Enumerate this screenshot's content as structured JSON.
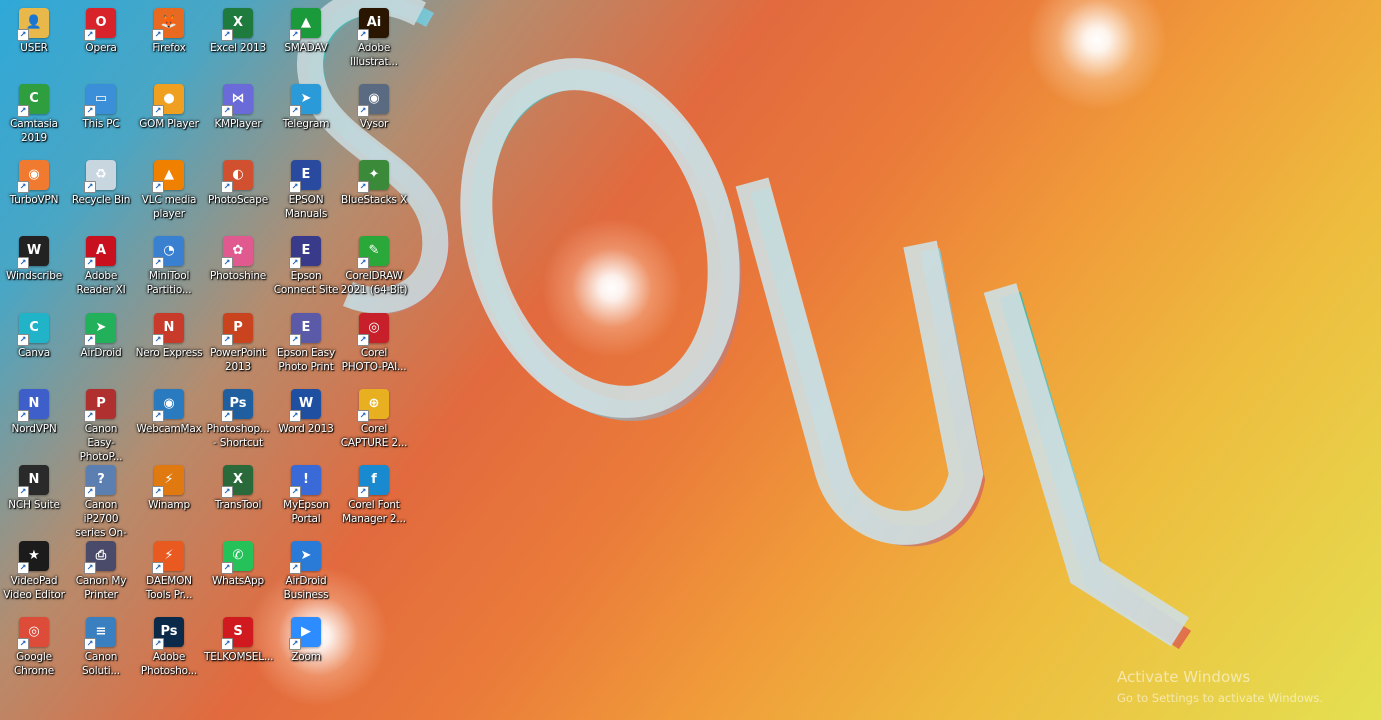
{
  "desktop": {
    "icons": [
      {
        "label": "USER",
        "icon": "user-folder-icon",
        "color": "#e8b84a",
        "glyph": "👤"
      },
      {
        "label": "Camtasia\n2019",
        "icon": "camtasia-icon",
        "color": "#2e9e3f",
        "glyph": "C"
      },
      {
        "label": "TurboVPN",
        "icon": "turbovpn-icon",
        "color": "#f07a30",
        "glyph": "◉"
      },
      {
        "label": "Windscribe",
        "icon": "windscribe-icon",
        "color": "#222222",
        "glyph": "W"
      },
      {
        "label": "Canva",
        "icon": "canva-icon",
        "color": "#21b4c8",
        "glyph": "C"
      },
      {
        "label": "NordVPN",
        "icon": "nordvpn-icon",
        "color": "#3e5fc9",
        "glyph": "N"
      },
      {
        "label": "NCH Suite",
        "icon": "nch-suite-icon",
        "color": "#2a2a2a",
        "glyph": "N"
      },
      {
        "label": "VideoPad\nVideo Editor",
        "icon": "videopad-icon",
        "color": "#1b1b1b",
        "glyph": "★"
      },
      {
        "label": "Google\nChrome",
        "icon": "chrome-icon",
        "color": "#dd4b39",
        "glyph": "◎"
      },
      {
        "label": "Opera",
        "icon": "opera-icon",
        "color": "#d8232a",
        "glyph": "O"
      },
      {
        "label": "This PC",
        "icon": "this-pc-icon",
        "color": "#3a8fd8",
        "glyph": "▭"
      },
      {
        "label": "Recycle Bin",
        "icon": "recycle-bin-icon",
        "color": "#c8d6e0",
        "glyph": "♻"
      },
      {
        "label": "Adobe\nReader XI",
        "icon": "adobe-reader-icon",
        "color": "#c8101e",
        "glyph": "A"
      },
      {
        "label": "AirDroid",
        "icon": "airdroid-icon",
        "color": "#22b05a",
        "glyph": "➤"
      },
      {
        "label": "Canon\nEasy-PhotoP...",
        "icon": "canon-easy-photoprint-icon",
        "color": "#b03030",
        "glyph": "P"
      },
      {
        "label": "Canon iP2700\nseries On-sc...",
        "icon": "canon-manual-icon",
        "color": "#5a7fb0",
        "glyph": "?"
      },
      {
        "label": "Canon My\nPrinter",
        "icon": "canon-my-printer-icon",
        "color": "#4a4a6a",
        "glyph": "⎙"
      },
      {
        "label": "Canon\nSoluti...",
        "icon": "canon-solution-icon",
        "color": "#3a80c0",
        "glyph": "≡"
      },
      {
        "label": "Firefox",
        "icon": "firefox-icon",
        "color": "#e86a20",
        "glyph": "🦊"
      },
      {
        "label": "GOM Player",
        "icon": "gom-player-icon",
        "color": "#f0a020",
        "glyph": "●"
      },
      {
        "label": "VLC media\nplayer",
        "icon": "vlc-icon",
        "color": "#f08000",
        "glyph": "▲"
      },
      {
        "label": "MiniTool\nPartitio...",
        "icon": "minitool-partition-icon",
        "color": "#3a80d0",
        "glyph": "◔"
      },
      {
        "label": "Nero Express",
        "icon": "nero-express-icon",
        "color": "#c83a2a",
        "glyph": "N"
      },
      {
        "label": "WebcamMax",
        "icon": "webcammax-icon",
        "color": "#2a7ac0",
        "glyph": "◉"
      },
      {
        "label": "Winamp",
        "icon": "winamp-icon",
        "color": "#e07a10",
        "glyph": "⚡"
      },
      {
        "label": "DAEMON\nTools Pr...",
        "icon": "daemon-tools-icon",
        "color": "#e85a20",
        "glyph": "⚡"
      },
      {
        "label": "Adobe\nPhotosho...",
        "icon": "adobe-photoshop-icon",
        "color": "#0b2a4a",
        "glyph": "Ps"
      },
      {
        "label": "Excel 2013",
        "icon": "excel-icon",
        "color": "#1f7a3e",
        "glyph": "X"
      },
      {
        "label": "KMPlayer",
        "icon": "kmplayer-icon",
        "color": "#6a6ad8",
        "glyph": "⋈"
      },
      {
        "label": "PhotoScape",
        "icon": "photoscape-icon",
        "color": "#d05030",
        "glyph": "◐"
      },
      {
        "label": "Photoshine",
        "icon": "photoshine-icon",
        "color": "#e05a90",
        "glyph": "✿"
      },
      {
        "label": "PowerPoint\n2013",
        "icon": "powerpoint-icon",
        "color": "#c8431e",
        "glyph": "P"
      },
      {
        "label": "Photoshop...\n- Shortcut",
        "icon": "photoshop-shortcut-icon",
        "color": "#1f5fa0",
        "glyph": "Ps"
      },
      {
        "label": "TransTool",
        "icon": "transtool-icon",
        "color": "#2a6a3a",
        "glyph": "X"
      },
      {
        "label": "WhatsApp",
        "icon": "whatsapp-icon",
        "color": "#25c25a",
        "glyph": "✆"
      },
      {
        "label": "TELKOMSEL...",
        "icon": "telkomsel-icon",
        "color": "#d01a20",
        "glyph": "S"
      },
      {
        "label": "SMADAV",
        "icon": "smadav-icon",
        "color": "#1a9a3a",
        "glyph": "▲"
      },
      {
        "label": "Telegram",
        "icon": "telegram-icon",
        "color": "#2a9ad8",
        "glyph": "➤"
      },
      {
        "label": "EPSON\nManuals",
        "icon": "epson-manuals-icon",
        "color": "#2a4aa0",
        "glyph": "E"
      },
      {
        "label": "Epson\nConnect Site",
        "icon": "epson-connect-icon",
        "color": "#3a3a8a",
        "glyph": "E"
      },
      {
        "label": "Epson Easy\nPhoto Print",
        "icon": "epson-easy-photo-print-icon",
        "color": "#5a5aa8",
        "glyph": "E"
      },
      {
        "label": "Word 2013",
        "icon": "word-icon",
        "color": "#1f4fa0",
        "glyph": "W"
      },
      {
        "label": "MyEpson\nPortal",
        "icon": "myepson-portal-icon",
        "color": "#3a6ad8",
        "glyph": "!"
      },
      {
        "label": "AirDroid\nBusiness",
        "icon": "airdroid-business-icon",
        "color": "#2a7ad8",
        "glyph": "➤"
      },
      {
        "label": "Zoom",
        "icon": "zoom-icon",
        "color": "#2d8cff",
        "glyph": "▶"
      },
      {
        "label": "Adobe\nIllustrat...",
        "icon": "adobe-illustrator-icon",
        "color": "#2a1600",
        "glyph": "Ai"
      },
      {
        "label": "Vysor",
        "icon": "vysor-icon",
        "color": "#5a6a80",
        "glyph": "◉"
      },
      {
        "label": "BlueStacks X",
        "icon": "bluestacks-icon",
        "color": "#3a8a3a",
        "glyph": "✦"
      },
      {
        "label": "CorelDRAW\n2021 (64-Bit)",
        "icon": "coreldraw-icon",
        "color": "#2aa83a",
        "glyph": "✎"
      },
      {
        "label": "Corel\nPHOTO-PAI...",
        "icon": "corel-photo-paint-icon",
        "color": "#c8202a",
        "glyph": "◎"
      },
      {
        "label": "Corel\nCAPTURE 2...",
        "icon": "corel-capture-icon",
        "color": "#e8b020",
        "glyph": "⊕"
      },
      {
        "label": "Corel Font\nManager 2...",
        "icon": "corel-font-manager-icon",
        "color": "#1a8ad0",
        "glyph": "f"
      }
    ],
    "wallpaper_text": "SOUL"
  },
  "activation_watermark": {
    "title": "Activate Windows",
    "subtitle": "Go to Settings to activate Windows."
  }
}
